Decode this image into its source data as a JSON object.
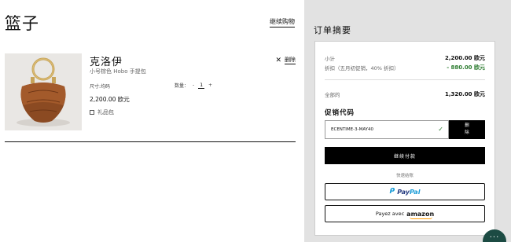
{
  "cart": {
    "title": "篮子",
    "continue_label": "继续购物",
    "item": {
      "image": "hobo-bag-image",
      "name": "克洛伊",
      "subtitle": "小号棕色 Hobo 手提包",
      "remove_label": "删除",
      "size_label": "尺寸:均码",
      "qty_label": "数量：",
      "qty_minus": "-",
      "qty_value": "1",
      "qty_plus": "+",
      "price": "2,200.00 欧元",
      "gift_label": "礼品包"
    }
  },
  "summary": {
    "title": "订单摘要",
    "subtotal_label": "小计",
    "subtotal_value": "2,200.00 欧元",
    "discount_label": "折扣（五月初促销，40% 折扣）",
    "discount_value": "- 880.00 欧元",
    "total_label": "全部的",
    "total_value": "1,320.00 欧元",
    "promo_title": "促销代码",
    "promo_code": "ECENTIME-3-MAY40",
    "promo_remove_line1": "删",
    "promo_remove_line2": "除",
    "checkout_label": "继续付款",
    "quick_checkout_label": "快速结账",
    "paypal_pay": "Pay",
    "paypal_pal": "Pal",
    "amazon_prefix": "Payez avec",
    "amazon_brand": "amazon"
  },
  "chat": {
    "icon": "chat-icon"
  },
  "colors": {
    "accent": "#000000",
    "discount": "#2e7d32",
    "panel": "#e2e2e2",
    "chat": "#1c4b43"
  }
}
